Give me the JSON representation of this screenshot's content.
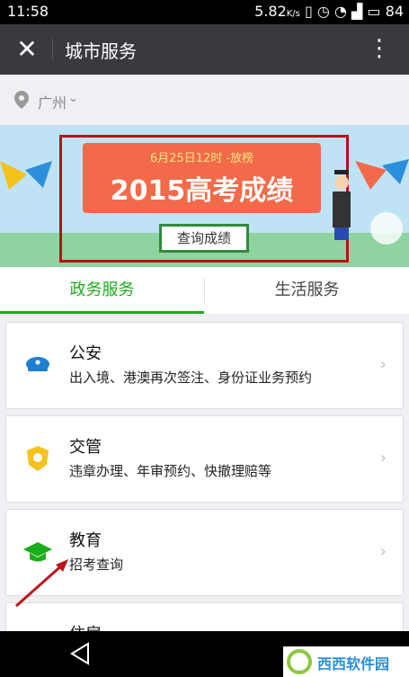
{
  "status": {
    "time": "11:58",
    "net_speed": "5.82",
    "net_unit": "K/s",
    "battery": "84"
  },
  "appbar": {
    "title": "城市服务"
  },
  "location": {
    "city": "广州"
  },
  "banner": {
    "subtitle": "6月25日12时 -放榜",
    "headline": "2015高考成绩",
    "button": "查询成绩"
  },
  "tabs": [
    {
      "label": "政务服务"
    },
    {
      "label": "生活服务"
    }
  ],
  "services": [
    {
      "title": "公安",
      "desc": "出入境、港澳再次签注、身份证业务预约"
    },
    {
      "title": "交管",
      "desc": "违章办理、年审预约、快撤理赔等"
    },
    {
      "title": "教育",
      "desc": "招考查询"
    },
    {
      "title": "住房",
      "desc": ""
    }
  ],
  "watermark": "西西软件园",
  "colors": {
    "accent": "#1aad19",
    "appbar": "#393a3f",
    "banner_red": "#f26a4a",
    "frame_red": "#b80f16"
  }
}
